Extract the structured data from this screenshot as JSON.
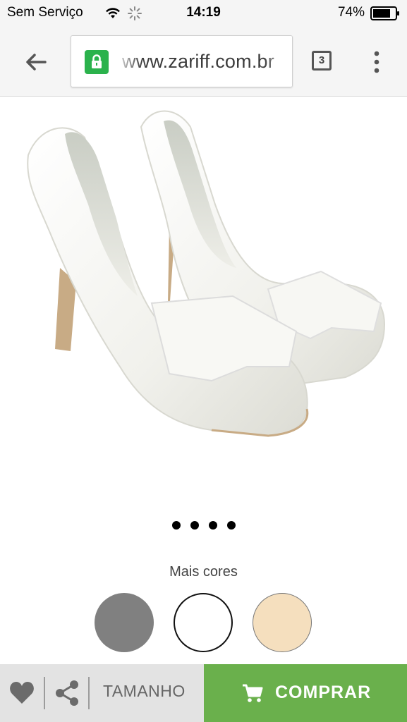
{
  "status_bar": {
    "carrier": "Sem Serviço",
    "time": "14:19",
    "battery": "74%"
  },
  "browser": {
    "url": "www.zariff.com.br",
    "tab_count": "3",
    "icons": [
      "back-arrow-icon",
      "lock-icon",
      "tabs-icon",
      "overflow-menu-icon"
    ]
  },
  "product": {
    "image_description_icon": "wedding-shoes-image",
    "carousel_dots": 4
  },
  "colors": {
    "label": "Mais cores",
    "swatches": [
      {
        "name": "gray",
        "hex": "#808080"
      },
      {
        "name": "white",
        "hex": "#ffffff"
      },
      {
        "name": "beige",
        "hex": "#f5dfbe"
      }
    ]
  },
  "actions": {
    "size_label": "TAMANHO",
    "buy_label": "COMPRAR",
    "buy_color": "#6ab04c",
    "left_bg": "#e3e3e3"
  }
}
